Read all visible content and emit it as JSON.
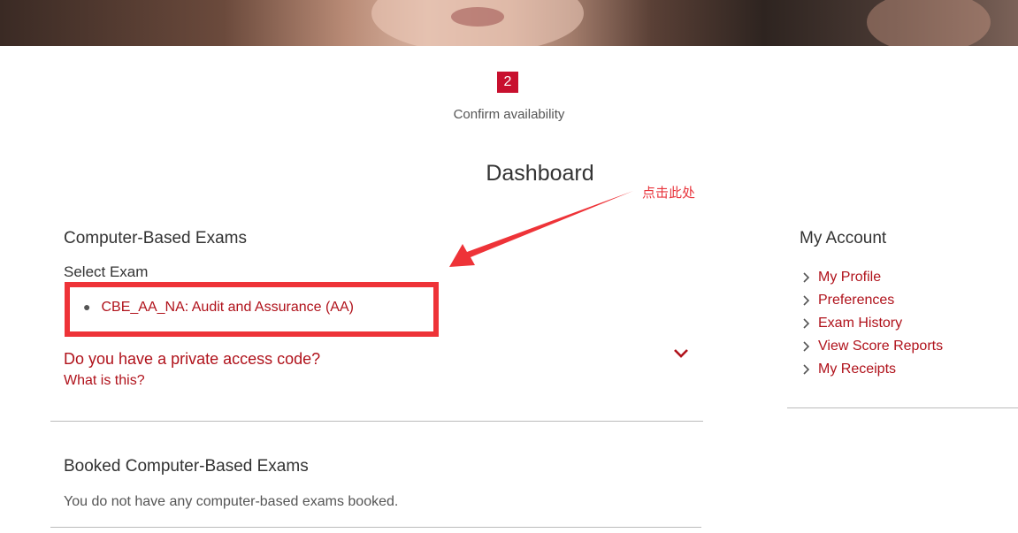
{
  "step": {
    "number": "2",
    "label": "Confirm availability"
  },
  "page_title": "Dashboard",
  "annotation": {
    "text": "点击此处"
  },
  "cbe": {
    "heading": "Computer-Based Exams",
    "select_label": "Select Exam",
    "exams": [
      {
        "label": "CBE_AA_NA: Audit and Assurance (AA)"
      }
    ],
    "access_code_label": "Do you have a private access code?",
    "what_is_this": "What is this?"
  },
  "booked": {
    "heading": "Booked Computer-Based Exams",
    "empty_text": "You do not have any computer-based exams booked."
  },
  "account": {
    "heading": "My Account",
    "links": [
      {
        "label": "My Profile"
      },
      {
        "label": "Preferences"
      },
      {
        "label": "Exam History"
      },
      {
        "label": "View Score Reports"
      },
      {
        "label": "My Receipts"
      }
    ]
  },
  "colors": {
    "brand_red": "#c8102e",
    "link_red": "#b0121b",
    "annotation_red": "#ee3338"
  }
}
